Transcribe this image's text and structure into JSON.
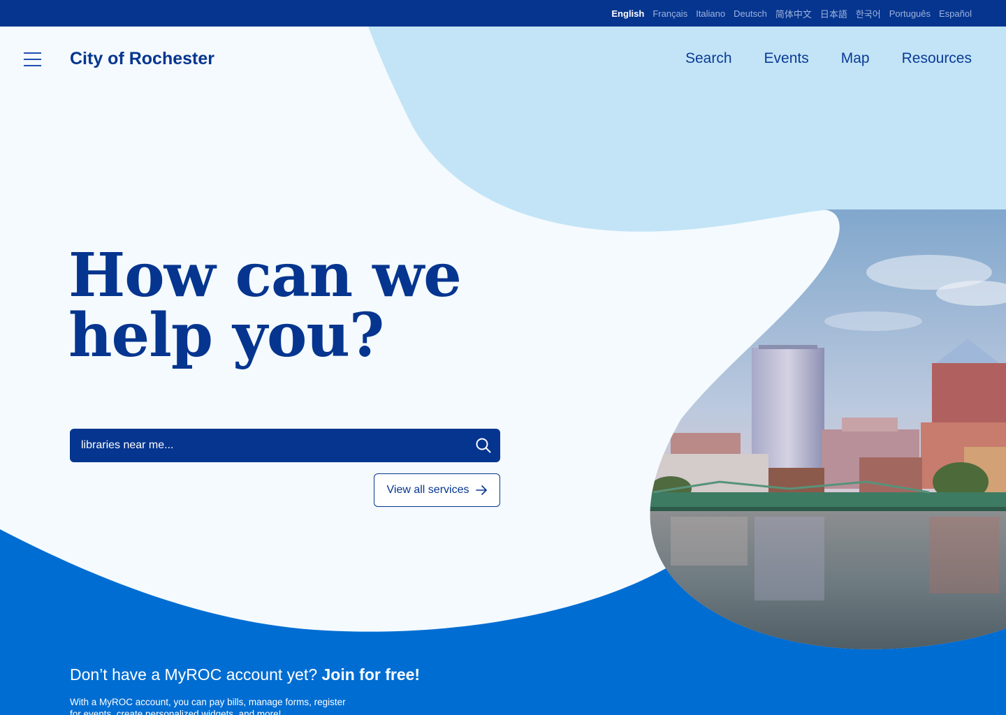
{
  "languages": [
    {
      "label": "English",
      "active": true
    },
    {
      "label": "Français",
      "active": false
    },
    {
      "label": "Italiano",
      "active": false
    },
    {
      "label": "Deutsch",
      "active": false
    },
    {
      "label": "简体中文",
      "active": false
    },
    {
      "label": "日本語",
      "active": false
    },
    {
      "label": "한국어",
      "active": false
    },
    {
      "label": "Português",
      "active": false
    },
    {
      "label": "Español",
      "active": false
    }
  ],
  "header": {
    "menu_icon": "hamburger-menu-icon",
    "logo": "City of Rochester",
    "nav": [
      "Search",
      "Events",
      "Map",
      "Resources"
    ]
  },
  "hero": {
    "title_line1": "How can we",
    "title_line2": "help you?",
    "search_placeholder": "libraries near me...",
    "search_icon": "search-icon",
    "services_label": "View all services",
    "services_icon": "arrow-right-icon",
    "image": "rochester-skyline-river-photo"
  },
  "join": {
    "question": "Don’t have a MyROC account yet?",
    "cta": "Join for free!",
    "description": "With a MyROC account, you can pay bills, manage forms, register for events, create personalized widgets, and more!"
  },
  "colors": {
    "navy": "#05358F",
    "blue": "#006DD2",
    "light_blue": "#C3E4F6",
    "background": "#F4FAFE"
  }
}
